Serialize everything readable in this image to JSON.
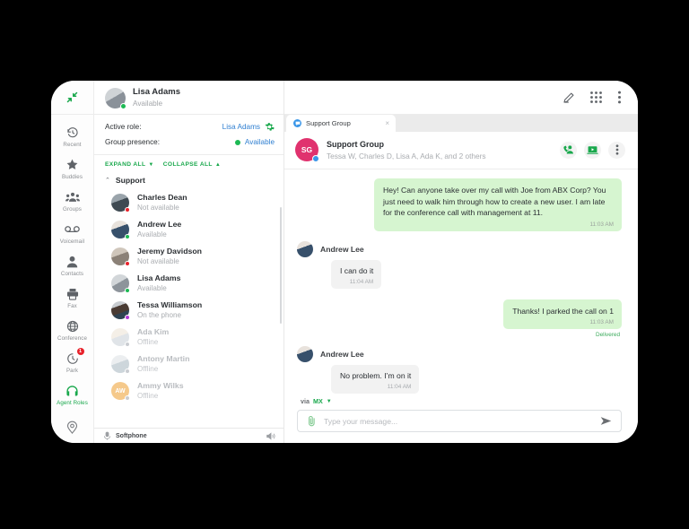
{
  "window": {
    "collapse_icon": "collapse-arrows-icon"
  },
  "rail": {
    "items": [
      {
        "label": "Recent",
        "icon": "clock-history-icon",
        "active": false,
        "badge": ""
      },
      {
        "label": "Buddies",
        "icon": "star-icon",
        "active": false,
        "badge": ""
      },
      {
        "label": "Groups",
        "icon": "people-group-icon",
        "active": false,
        "badge": ""
      },
      {
        "label": "Voicemail",
        "icon": "voicemail-icon",
        "active": false,
        "badge": ""
      },
      {
        "label": "Contacts",
        "icon": "person-icon",
        "active": false,
        "badge": ""
      },
      {
        "label": "Fax",
        "icon": "printer-fax-icon",
        "active": false,
        "badge": ""
      },
      {
        "label": "Conference",
        "icon": "globe-icon",
        "active": false,
        "badge": ""
      },
      {
        "label": "Park",
        "icon": "park-clock-icon",
        "active": false,
        "badge": "1"
      },
      {
        "label": "Agent Roles",
        "icon": "headset-icon",
        "active": true,
        "badge": ""
      }
    ],
    "bottom_icon": "location-pin-icon"
  },
  "me": {
    "name": "Lisa Adams",
    "status": "Available",
    "presence": "available"
  },
  "role_panel": {
    "active_role_label": "Active role:",
    "active_role_value": "Lisa Adams",
    "gear_icon": "gear-icon",
    "group_presence_label": "Group presence:",
    "group_presence_value": "Available"
  },
  "list_controls": {
    "expand_all": "EXPAND ALL",
    "collapse_all": "COLLAPSE ALL"
  },
  "contact_group": {
    "name": "Support",
    "expanded": true,
    "contacts": [
      {
        "name": "Charles Dean",
        "status": "Not available",
        "presence": "dnd",
        "dim": false,
        "initials": "CD",
        "av_color": "#7d8b93"
      },
      {
        "name": "Andrew Lee",
        "status": "Available",
        "presence": "available",
        "dim": false,
        "initials": "AL",
        "av_color": "#6b7d8a"
      },
      {
        "name": "Jeremy Davidson",
        "status": "Not available",
        "presence": "dnd",
        "dim": false,
        "initials": "JD",
        "av_color": "#8c8378"
      },
      {
        "name": "Lisa Adams",
        "status": "Available",
        "presence": "available",
        "dim": false,
        "initials": "LA",
        "av_color": "#b3b6ba"
      },
      {
        "name": "Tessa Williamson",
        "status": "On the phone",
        "presence": "phone",
        "dim": false,
        "initials": "TW",
        "av_color": "#5a6b78"
      },
      {
        "name": "Ada Kim",
        "status": "Offline",
        "presence": "offline",
        "dim": true,
        "initials": "AK",
        "av_color": "#d8cfc6"
      },
      {
        "name": "Antony Martin",
        "status": "Offline",
        "presence": "offline",
        "dim": true,
        "initials": "AM",
        "av_color": "#ccd2d6"
      },
      {
        "name": "Ammy Wilks",
        "status": "Offline",
        "presence": "offline",
        "dim": true,
        "initials": "AW",
        "av_color": "#f3c98e"
      }
    ]
  },
  "softphone": {
    "label": "Softphone",
    "left_icon": "softphone-icon",
    "right_icon": "speaker-volume-icon"
  },
  "toolbar": {
    "compose_icon": "pencil-edit-icon",
    "dialpad_icon": "dialpad-grid-icon",
    "more_icon": "more-vertical-icon"
  },
  "tabs": [
    {
      "label": "Support Group",
      "icon": "chat-bubble-icon",
      "close": "×",
      "active": true
    }
  ],
  "conversation": {
    "title": "Support Group",
    "initials": "SG",
    "subtitle": "Tessa W, Charles D, Lisa A, Ada K, and 2 others",
    "avatar_color": "#e0326e",
    "actions": [
      {
        "name": "add-person-call-icon"
      },
      {
        "name": "screen-share-icon"
      },
      {
        "name": "more-vertical-icon"
      }
    ]
  },
  "messages": [
    {
      "direction": "out",
      "text": "Hey! Can anyone take over my call with Joe from ABX Corp? You just need to walk him through how to create a new user. I am late for the conference call with management at 11.",
      "time": "11:03 AM",
      "receipt": ""
    },
    {
      "direction": "in",
      "sender": "Andrew Lee",
      "text": "I can do it",
      "time": "11:04 AM"
    },
    {
      "direction": "out",
      "text": "Thanks! I parked the call on 1",
      "time": "11:03 AM",
      "receipt": "Delivered"
    },
    {
      "direction": "in",
      "sender": "Andrew Lee",
      "text": "No problem. I’m on it",
      "time": "11:04 AM"
    }
  ],
  "composer": {
    "via_label": "via",
    "via_value": "MX",
    "placeholder": "Type your message...",
    "value": "",
    "attach_icon": "paperclip-icon",
    "send_icon": "send-arrow-icon"
  },
  "colors": {
    "accent_green": "#19a84c",
    "link_blue": "#2f7fd1",
    "bubble_out": "#d6f5d0",
    "bubble_in": "#f2f2f2",
    "badge_red": "#e8222b",
    "group_pink": "#e0326e"
  }
}
